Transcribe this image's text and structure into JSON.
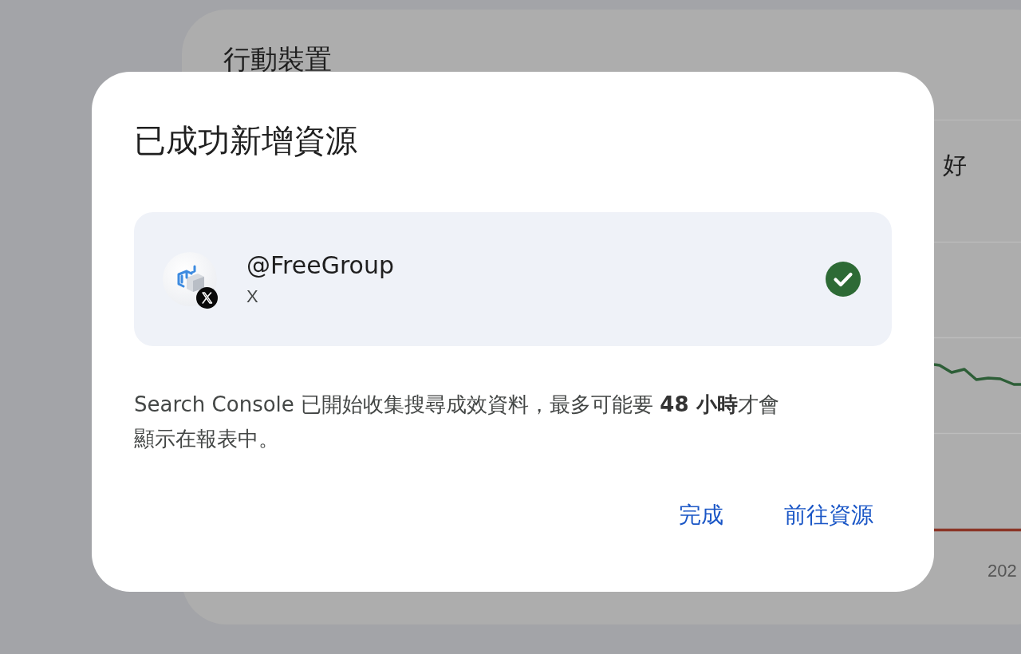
{
  "background": {
    "card_title": "行動裝置",
    "chart_label": "好",
    "axis_label": "202"
  },
  "dialog": {
    "title": "已成功新增資源",
    "resource": {
      "name": "@FreeGroup",
      "platform": "X",
      "verified": true
    },
    "message": "Search Console 已開始收集搜尋成效資料，最多可能要 **48 小時**才會顯示在報表中。",
    "buttons": [
      {
        "label": "完成"
      },
      {
        "label": "前往資源"
      }
    ]
  }
}
